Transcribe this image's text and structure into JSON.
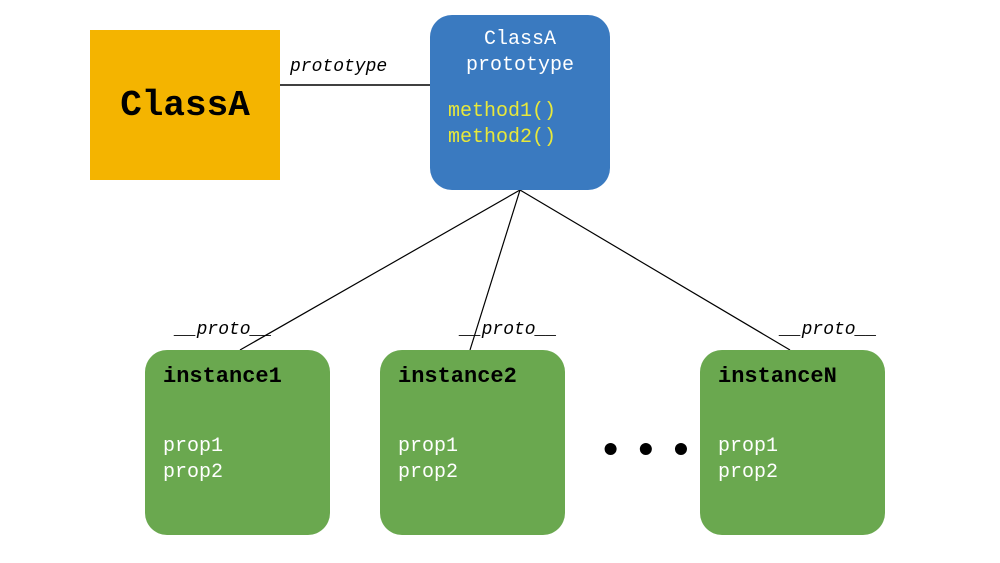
{
  "class": {
    "name": "ClassA"
  },
  "prototype_label": "prototype",
  "prototype": {
    "title_line1": "ClassA",
    "title_line2": "prototype",
    "methods": [
      "method1()",
      "method2()"
    ]
  },
  "proto_label": "__proto__",
  "instances": [
    {
      "name": "instance1",
      "props": [
        "prop1",
        "prop2"
      ]
    },
    {
      "name": "instance2",
      "props": [
        "prop1",
        "prop2"
      ]
    },
    {
      "name": "instanceN",
      "props": [
        "prop1",
        "prop2"
      ]
    }
  ],
  "ellipsis": "•••"
}
